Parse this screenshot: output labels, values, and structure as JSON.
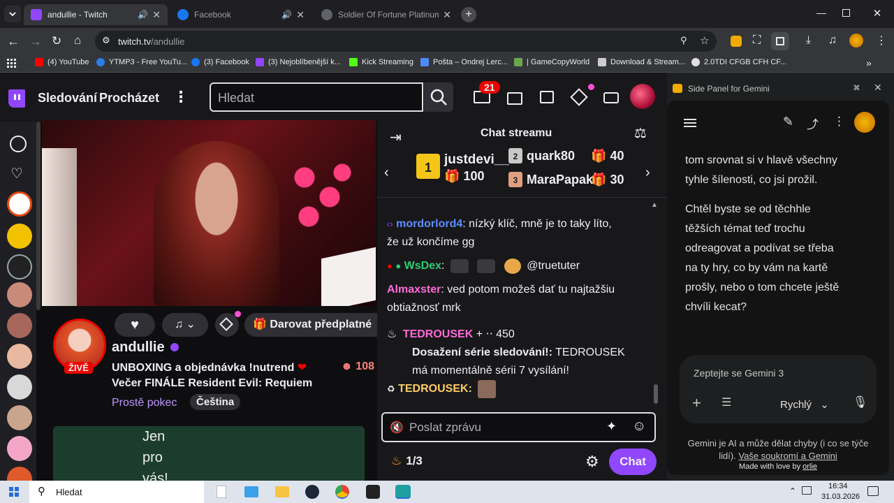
{
  "browser": {
    "tabs": [
      {
        "title": "andullie - Twitch",
        "active": true
      },
      {
        "title": "Facebook",
        "active": false
      },
      {
        "title": "Soldier Of Fortune Platinum Edí",
        "active": false
      }
    ],
    "url_host": "twitch.tv",
    "url_path": "/andullie",
    "bookmarks": [
      {
        "label": "(4) YouTube",
        "color": "#ff0000"
      },
      {
        "label": "YTMP3 - Free YouTu...",
        "color": "#2b7de9"
      },
      {
        "label": "(3) Facebook",
        "color": "#1877f2"
      },
      {
        "label": "(3) Nejoblíbenější k...",
        "color": "#9147ff"
      },
      {
        "label": "Kick Streaming",
        "color": "#53fc18"
      },
      {
        "label": "Pošta – Ondrej Lerc...",
        "color": "#4c8bf5"
      },
      {
        "label": "| GameCopyWorld",
        "color": "#6aa84f"
      },
      {
        "label": "Download & Stream...",
        "color": "#cccccc"
      },
      {
        "label": "2.0TDI CFGB CFH CF...",
        "color": "#e0e0e0"
      }
    ]
  },
  "twitch": {
    "nav": {
      "following": "Sledování",
      "browse": "Procházet",
      "search_placeholder": "Hledat",
      "notif_count": "21"
    },
    "channel": {
      "name": "andullie",
      "live_badge": "ŽIVĚ",
      "title_line1": "UNBOXING a objednávka !nutrend",
      "title_line2": "Večer FINÁLE Resident Evil: Requiem",
      "category": "Prostě pokec",
      "language": "Čeština",
      "viewers": "108",
      "gift_sub": "Darovat předplatné",
      "panel_text": [
        "Jen",
        "pro",
        "vás!"
      ]
    },
    "chat": {
      "header": "Chat streamu",
      "leaderboard": [
        {
          "rank": "1",
          "name": "justdevi__",
          "count": "100"
        },
        {
          "rank": "2",
          "name": "quark80",
          "count": "40"
        },
        {
          "rank": "3",
          "name": "MaraPapak",
          "count": "30"
        }
      ],
      "messages": [
        {
          "user": "mordorlord4",
          "color": "#5c8dff",
          "text": "nízký klíč, mně je to taky líto,",
          "text2": "že už končíme gg"
        },
        {
          "user": "WsDex",
          "color": "#2ecc71",
          "text": "@truetuter"
        },
        {
          "user": "Almaxster",
          "color": "#ff6bd6",
          "text": "ved potom možeš dať tu najtažšiu",
          "text2": "obtiažnosť mrk"
        },
        {
          "user": "TEDROUSEK",
          "color": "#ff6bd6",
          "points": "450"
        },
        {
          "user": "TEDROUSEK:",
          "color": "#ffcc66"
        }
      ],
      "streak_title": "Dosažení série sledování!:",
      "streak_line1": "TEDROUSEK",
      "streak_line2": "má momentálně sérii 7 vysílání!",
      "input_placeholder": "Poslat zprávu",
      "progress": "1/3",
      "send_label": "Chat"
    }
  },
  "gemini": {
    "panel_title": "Side Panel for Gemini",
    "response": [
      "tom srovnat si v hlavě všechny",
      "tyhle šílenosti, co jsi prožil.",
      "",
      "Chtěl byste se od těchhle",
      "těžších témat teď trochu",
      "odreagovat a podívat se třeba",
      "na ty hry, co by vám na kartě",
      "prošly, nebo o tom chcete ještě",
      "chvíli kecat?"
    ],
    "prompt_placeholder": "Zeptejte se Gemini 3",
    "mode": "Rychlý",
    "disclaimer1": "Gemini je AI a může dělat chyby (i co se týče",
    "disclaimer2a": "lidí). ",
    "disclaimer2b": "Vaše soukromí a Gemini",
    "made_with": "Made with love by ",
    "author": "orlie"
  },
  "taskbar": {
    "search": "Hledat",
    "time": "16:34",
    "date": "31.03.2026"
  }
}
